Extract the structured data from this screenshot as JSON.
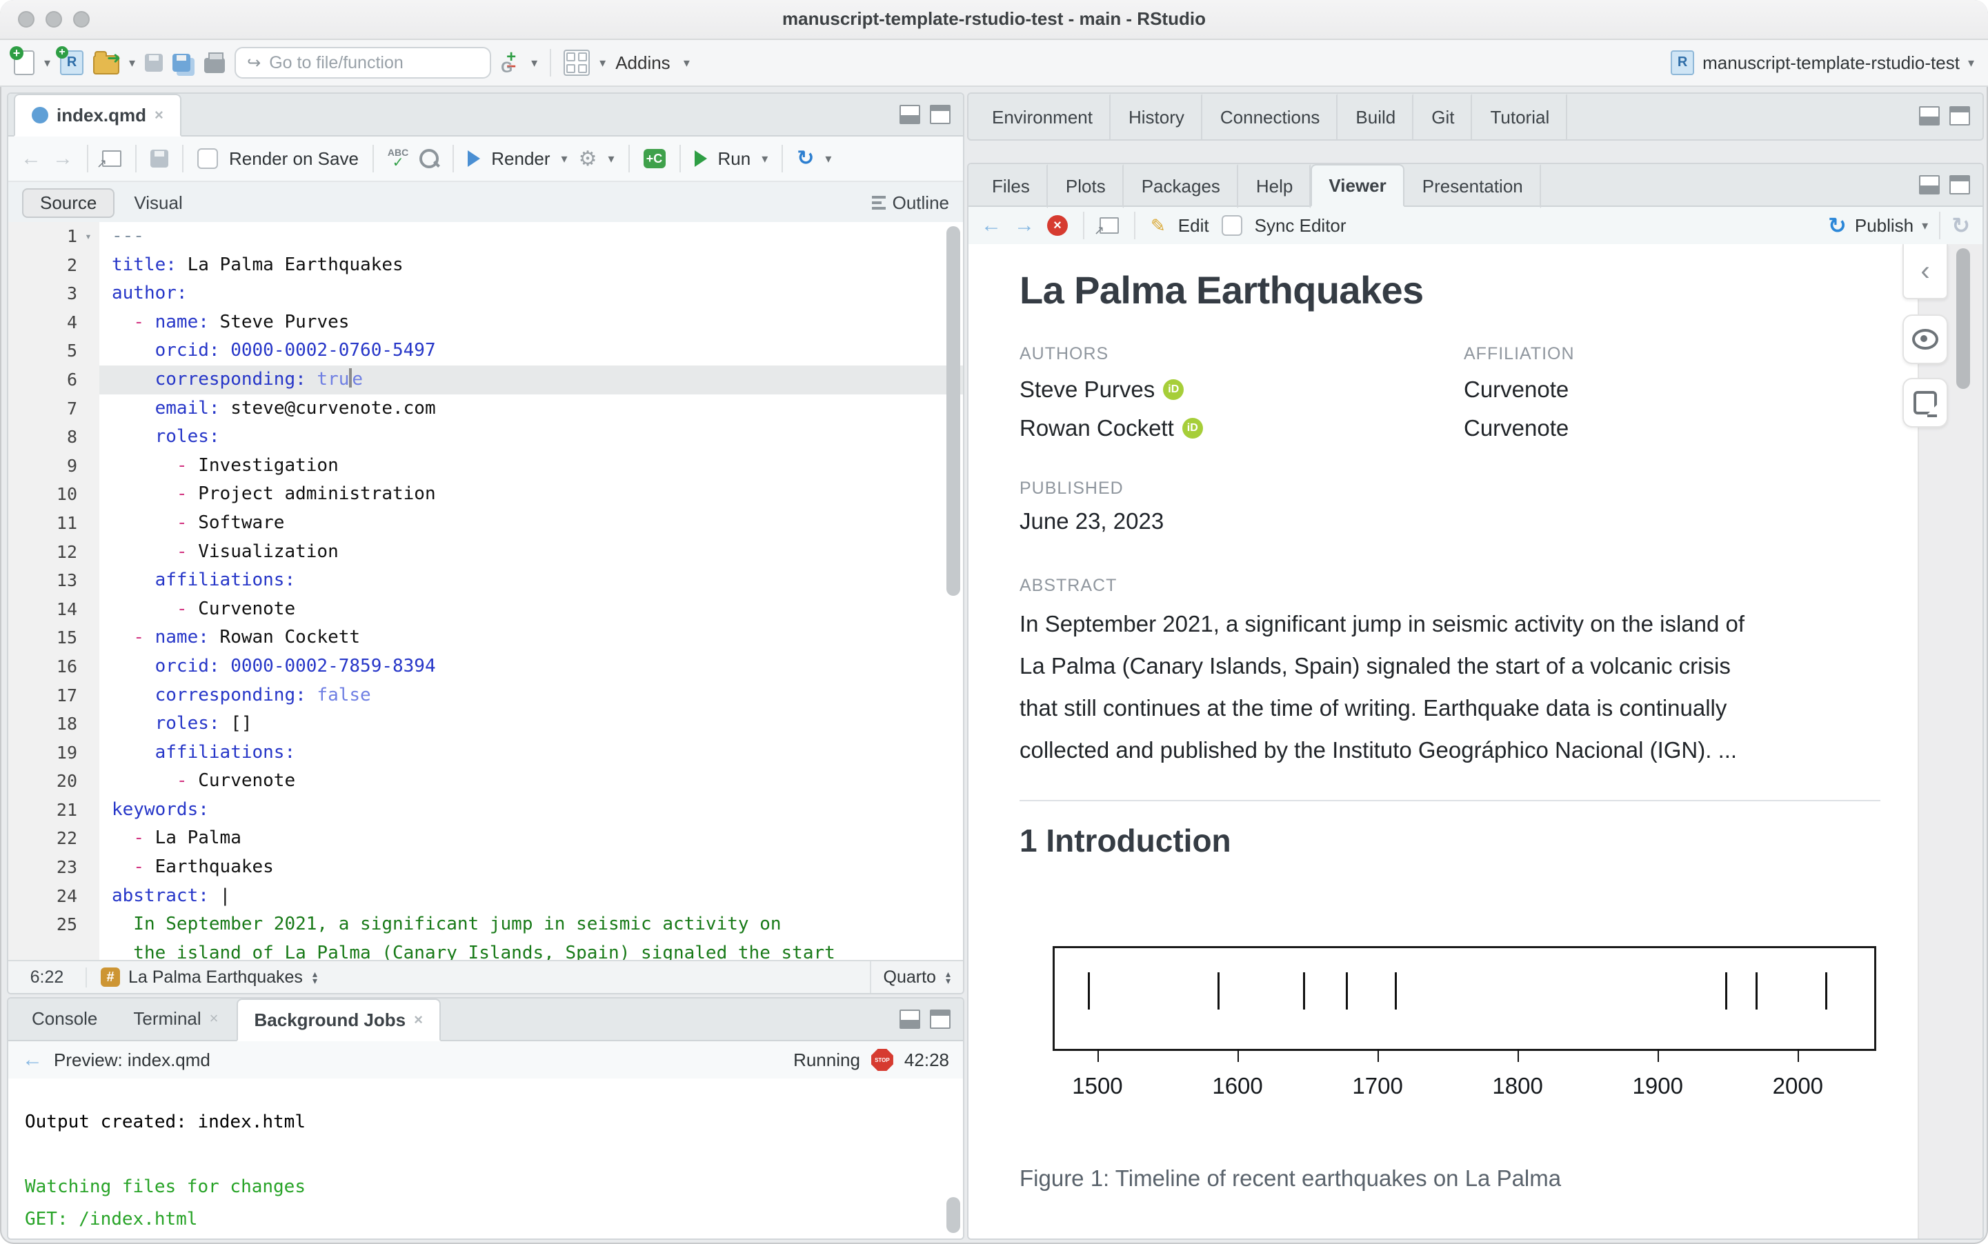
{
  "window": {
    "title": "manuscript-template-rstudio-test - main - RStudio"
  },
  "icons": {
    "caret": "▾",
    "back": "←",
    "forward": "→",
    "refresh": "↻",
    "publish": "↻",
    "pencil": "✎",
    "gear": "⚙",
    "chevron_left": "‹",
    "goto_arrow": "↪",
    "sort_up": "▴",
    "sort_down": "▾",
    "close_x": "×",
    "stop_text": "STOP",
    "spell_abc": "ABC",
    "spell_check": "✓",
    "plus": "+",
    "minus": "−",
    "git_letter": "G",
    "r_letter": "R",
    "folder_arrow": "➜"
  },
  "toolbar": {
    "goto_placeholder": "Go to file/function",
    "addins_label": "Addins",
    "project_label": "manuscript-template-rstudio-test"
  },
  "editor": {
    "tab_label": "index.qmd",
    "render_on_save": "Render on Save",
    "render_label": "Render",
    "run_label": "Run",
    "source_label": "Source",
    "visual_label": "Visual",
    "outline_label": "Outline",
    "status": {
      "cursor": "6:22",
      "section": "La Palma Earthquakes",
      "mode": "Quarto"
    },
    "lines": [
      {
        "num": "1",
        "fold": true,
        "tokens": [
          [
            "meta",
            "---"
          ]
        ]
      },
      {
        "num": "2",
        "tokens": [
          [
            "key",
            "title:"
          ],
          [
            "val",
            " La Palma Earthquakes"
          ]
        ]
      },
      {
        "num": "3",
        "tokens": [
          [
            "key",
            "author:"
          ]
        ]
      },
      {
        "num": "4",
        "tokens": [
          [
            "val",
            "  "
          ],
          [
            "dash",
            "-"
          ],
          [
            "val",
            " "
          ],
          [
            "key",
            "name:"
          ],
          [
            "val",
            " Steve Purves"
          ]
        ]
      },
      {
        "num": "5",
        "tokens": [
          [
            "val",
            "    "
          ],
          [
            "key",
            "orcid:"
          ],
          [
            "num2",
            " 0000-0002-0760-5497"
          ]
        ]
      },
      {
        "num": "6",
        "cursor": true,
        "tokens": [
          [
            "val",
            "    "
          ],
          [
            "key",
            "corresponding:"
          ],
          [
            "bool",
            " tru"
          ],
          [
            "caret",
            ""
          ],
          [
            "bool",
            "e"
          ]
        ]
      },
      {
        "num": "7",
        "tokens": [
          [
            "val",
            "    "
          ],
          [
            "key",
            "email:"
          ],
          [
            "val",
            " steve@curvenote.com"
          ]
        ]
      },
      {
        "num": "8",
        "tokens": [
          [
            "val",
            "    "
          ],
          [
            "key",
            "roles:"
          ]
        ]
      },
      {
        "num": "9",
        "tokens": [
          [
            "val",
            "      "
          ],
          [
            "dash",
            "-"
          ],
          [
            "val",
            " Investigation"
          ]
        ]
      },
      {
        "num": "10",
        "tokens": [
          [
            "val",
            "      "
          ],
          [
            "dash",
            "-"
          ],
          [
            "val",
            " Project administration"
          ]
        ]
      },
      {
        "num": "11",
        "tokens": [
          [
            "val",
            "      "
          ],
          [
            "dash",
            "-"
          ],
          [
            "val",
            " Software"
          ]
        ]
      },
      {
        "num": "12",
        "tokens": [
          [
            "val",
            "      "
          ],
          [
            "dash",
            "-"
          ],
          [
            "val",
            " Visualization"
          ]
        ]
      },
      {
        "num": "13",
        "tokens": [
          [
            "val",
            "    "
          ],
          [
            "key",
            "affiliations:"
          ]
        ]
      },
      {
        "num": "14",
        "tokens": [
          [
            "val",
            "      "
          ],
          [
            "dash",
            "-"
          ],
          [
            "val",
            " Curvenote"
          ]
        ]
      },
      {
        "num": "15",
        "tokens": [
          [
            "val",
            "  "
          ],
          [
            "dash",
            "-"
          ],
          [
            "val",
            " "
          ],
          [
            "key",
            "name:"
          ],
          [
            "val",
            " Rowan Cockett"
          ]
        ]
      },
      {
        "num": "16",
        "tokens": [
          [
            "val",
            "    "
          ],
          [
            "key",
            "orcid:"
          ],
          [
            "num2",
            " 0000-0002-7859-8394"
          ]
        ]
      },
      {
        "num": "17",
        "tokens": [
          [
            "val",
            "    "
          ],
          [
            "key",
            "corresponding:"
          ],
          [
            "bool",
            " false"
          ]
        ]
      },
      {
        "num": "18",
        "tokens": [
          [
            "val",
            "    "
          ],
          [
            "key",
            "roles:"
          ],
          [
            "val",
            " []"
          ]
        ]
      },
      {
        "num": "19",
        "tokens": [
          [
            "val",
            "    "
          ],
          [
            "key",
            "affiliations:"
          ]
        ]
      },
      {
        "num": "20",
        "tokens": [
          [
            "val",
            "      "
          ],
          [
            "dash",
            "-"
          ],
          [
            "val",
            " Curvenote"
          ]
        ]
      },
      {
        "num": "21",
        "tokens": [
          [
            "key",
            "keywords:"
          ]
        ]
      },
      {
        "num": "22",
        "tokens": [
          [
            "val",
            "  "
          ],
          [
            "dash",
            "-"
          ],
          [
            "val",
            " La Palma"
          ]
        ]
      },
      {
        "num": "23",
        "tokens": [
          [
            "val",
            "  "
          ],
          [
            "dash",
            "-"
          ],
          [
            "val",
            " Earthquakes"
          ]
        ]
      },
      {
        "num": "24",
        "tokens": [
          [
            "key",
            "abstract:"
          ],
          [
            "val",
            " |"
          ]
        ]
      },
      {
        "num": "25",
        "tokens": [
          [
            "str",
            "  In September 2021, a significant jump in seismic activity on"
          ]
        ]
      },
      {
        "num": "",
        "tokens": [
          [
            "str",
            "  the island of La Palma (Canary Islands, Spain) signaled the start"
          ]
        ]
      }
    ]
  },
  "console": {
    "tabs": [
      "Console",
      "Terminal",
      "Background Jobs"
    ],
    "active_tab": "Background Jobs",
    "closable_tabs": [
      "Terminal",
      "Background Jobs"
    ],
    "preview_label": "Preview: index.qmd",
    "status_label": "Running",
    "elapsed": "42:28",
    "output": [
      {
        "cls": "out-plain",
        "text": "Output created: index.html"
      },
      {
        "cls": "",
        "text": ""
      },
      {
        "cls": "out-green",
        "text": "Watching files for changes"
      },
      {
        "cls": "out-green",
        "text": "GET: /index.html"
      }
    ]
  },
  "right": {
    "top_tabs": [
      "Environment",
      "History",
      "Connections",
      "Build",
      "Git",
      "Tutorial"
    ],
    "viewer_tabs": [
      "Files",
      "Plots",
      "Packages",
      "Help",
      "Viewer",
      "Presentation"
    ],
    "viewer_active": "Viewer",
    "toolbar": {
      "edit_label": "Edit",
      "sync_label": "Sync Editor",
      "publish_label": "Publish"
    }
  },
  "document": {
    "title": "La Palma Earthquakes",
    "authors_label": "AUTHORS",
    "affiliation_label": "AFFILIATION",
    "authors": [
      {
        "name": "Steve Purves",
        "affiliation": "Curvenote"
      },
      {
        "name": "Rowan Cockett",
        "affiliation": "Curvenote"
      }
    ],
    "published_label": "PUBLISHED",
    "published": "June 23, 2023",
    "abstract_label": "ABSTRACT",
    "abstract_lines": [
      "In September 2021, a significant jump in seismic activity on the island of",
      "La Palma (Canary Islands, Spain) signaled the start of a volcanic crisis",
      "that still continues at the time of writing. Earthquake data is continually",
      "collected and published by the Instituto Geográphico Nacional (IGN). ..."
    ],
    "section_heading": "1 Introduction",
    "figure_caption": "Figure 1: Timeline of recent earthquakes on La Palma"
  },
  "chart_data": {
    "type": "rug-timeline",
    "title": "Timeline of recent earthquakes on La Palma",
    "x": [
      1492,
      1585,
      1646,
      1677,
      1712,
      1949,
      1971,
      2021
    ],
    "x_ticks": [
      1500,
      1600,
      1700,
      1800,
      1900,
      2000
    ],
    "xlim": [
      1468,
      2056
    ],
    "xlabel": "",
    "ylabel": "",
    "caption": "Figure 1: Timeline of recent earthquakes on La Palma"
  },
  "colors": {
    "yaml_key": "#2636c8",
    "yaml_dash": "#d33682",
    "yaml_bool": "#6f7fe3",
    "yaml_string": "#187a18",
    "console_green": "#27a327",
    "orcid_green": "#a6ce39",
    "status_hash": "#cd9533",
    "stop_red": "#d63b30",
    "publish_blue": "#2b87d8",
    "run_green": "#2e9e44"
  }
}
